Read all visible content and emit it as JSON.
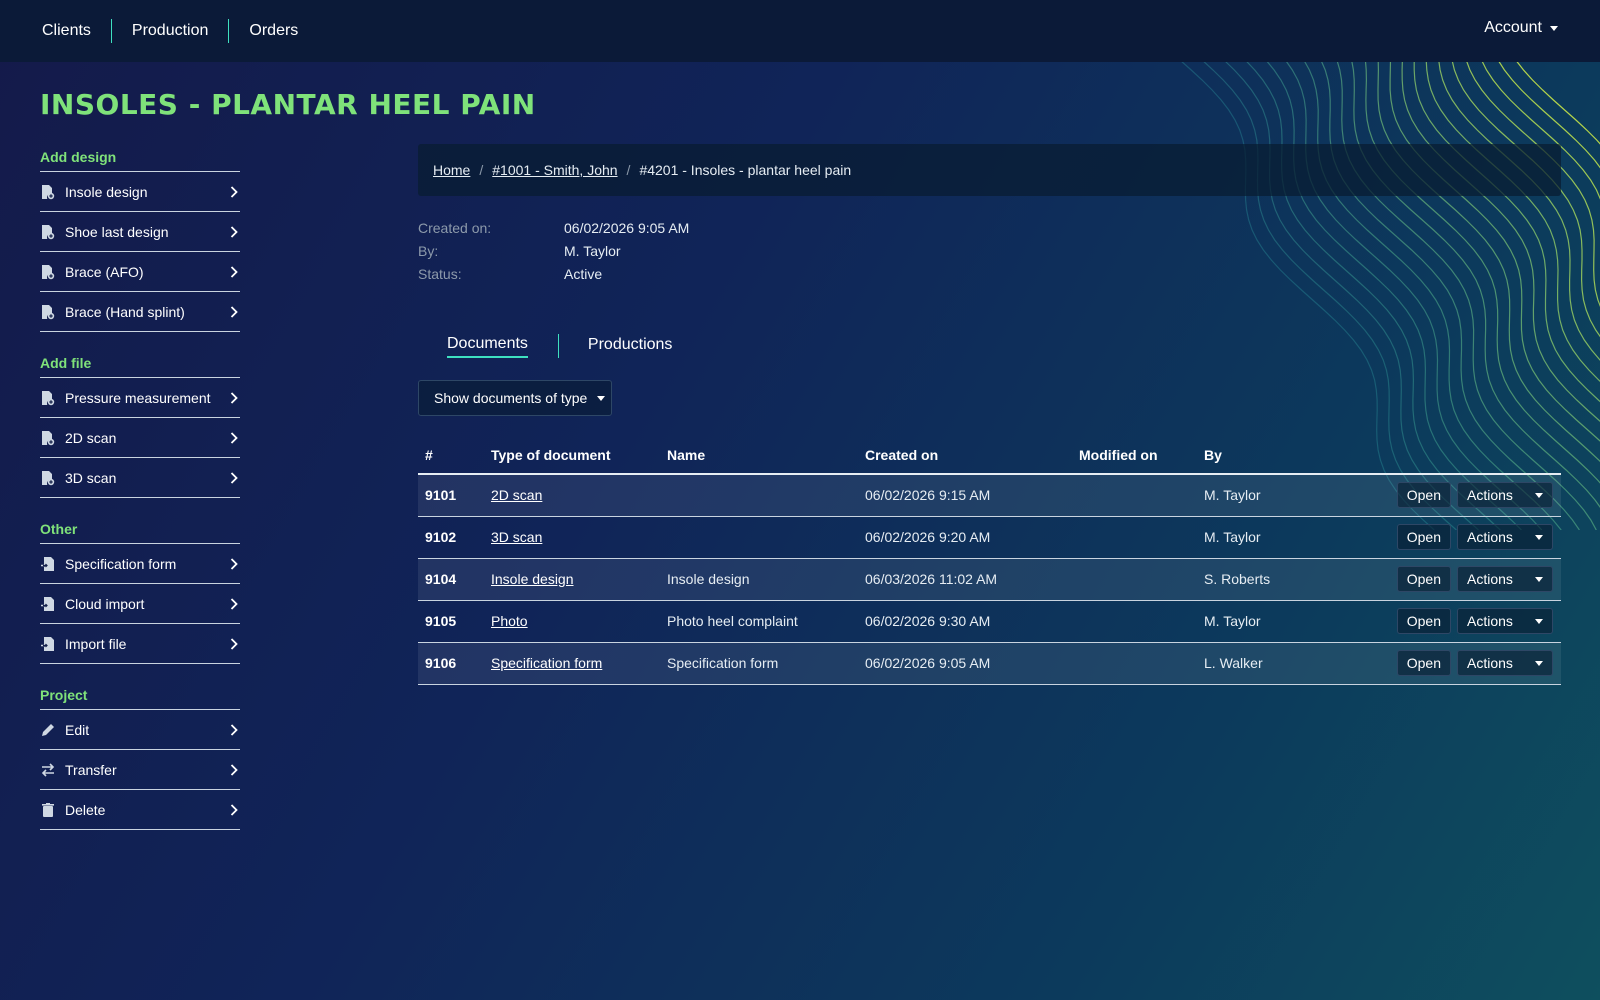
{
  "nav": {
    "items": [
      "Clients",
      "Production",
      "Orders"
    ],
    "account": "Account"
  },
  "page_title": "INSOLES - PLANTAR HEEL PAIN",
  "sidebar": {
    "groups": [
      {
        "heading": "Add design",
        "items": [
          {
            "label": "Insole design",
            "icon": "file-plus-icon"
          },
          {
            "label": "Shoe last design",
            "icon": "file-plus-icon"
          },
          {
            "label": "Brace (AFO)",
            "icon": "file-plus-icon"
          },
          {
            "label": "Brace (Hand splint)",
            "icon": "file-plus-icon"
          }
        ]
      },
      {
        "heading": "Add file",
        "items": [
          {
            "label": "Pressure measurement",
            "icon": "file-plus-icon"
          },
          {
            "label": "2D scan",
            "icon": "file-plus-icon"
          },
          {
            "label": "3D scan",
            "icon": "file-plus-icon"
          }
        ]
      },
      {
        "heading": "Other",
        "items": [
          {
            "label": "Specification form",
            "icon": "file-import-icon"
          },
          {
            "label": "Cloud import",
            "icon": "file-import-icon"
          },
          {
            "label": "Import file",
            "icon": "file-import-icon"
          }
        ]
      },
      {
        "heading": "Project",
        "items": [
          {
            "label": "Edit",
            "icon": "pencil-icon"
          },
          {
            "label": "Transfer",
            "icon": "transfer-icon"
          },
          {
            "label": "Delete",
            "icon": "trash-icon"
          }
        ]
      }
    ]
  },
  "breadcrumb": {
    "home": "Home",
    "client": "#1001 - Smith, John",
    "current": "#4201 - Insoles - plantar heel pain",
    "separator": "/"
  },
  "meta": {
    "created_label": "Created on:",
    "created_value": "06/02/2026 9:05 AM",
    "by_label": "By:",
    "by_value": "M. Taylor",
    "status_label": "Status:",
    "status_value": "Active"
  },
  "tabs": {
    "documents": "Documents",
    "productions": "Productions",
    "active": "Documents"
  },
  "filter": {
    "label": "Show documents of type"
  },
  "table": {
    "headers": [
      "#",
      "Type of document",
      "Name",
      "Created on",
      "Modified on",
      "By"
    ],
    "open_label": "Open",
    "actions_label": "Actions",
    "rows": [
      {
        "id": "9101",
        "type": "2D scan",
        "name": "",
        "created": "06/02/2026 9:15 AM",
        "modified": "",
        "by": "M. Taylor"
      },
      {
        "id": "9102",
        "type": "3D scan",
        "name": "",
        "created": "06/02/2026 9:20 AM",
        "modified": "",
        "by": "M. Taylor"
      },
      {
        "id": "9104",
        "type": "Insole design",
        "name": "Insole design",
        "created": "06/03/2026 11:02 AM",
        "modified": "",
        "by": "S. Roberts"
      },
      {
        "id": "9105",
        "type": "Photo",
        "name": "Photo heel complaint",
        "created": "06/02/2026 9:30 AM",
        "modified": "",
        "by": "M. Taylor"
      },
      {
        "id": "9106",
        "type": "Specification form",
        "name": "Specification form",
        "created": "06/02/2026 9:05 AM",
        "modified": "",
        "by": "L. Walker"
      }
    ]
  },
  "colors": {
    "accent_green": "#7fe27a",
    "accent_teal": "#3ee0c0",
    "nav_bg": "#0b1a38"
  }
}
